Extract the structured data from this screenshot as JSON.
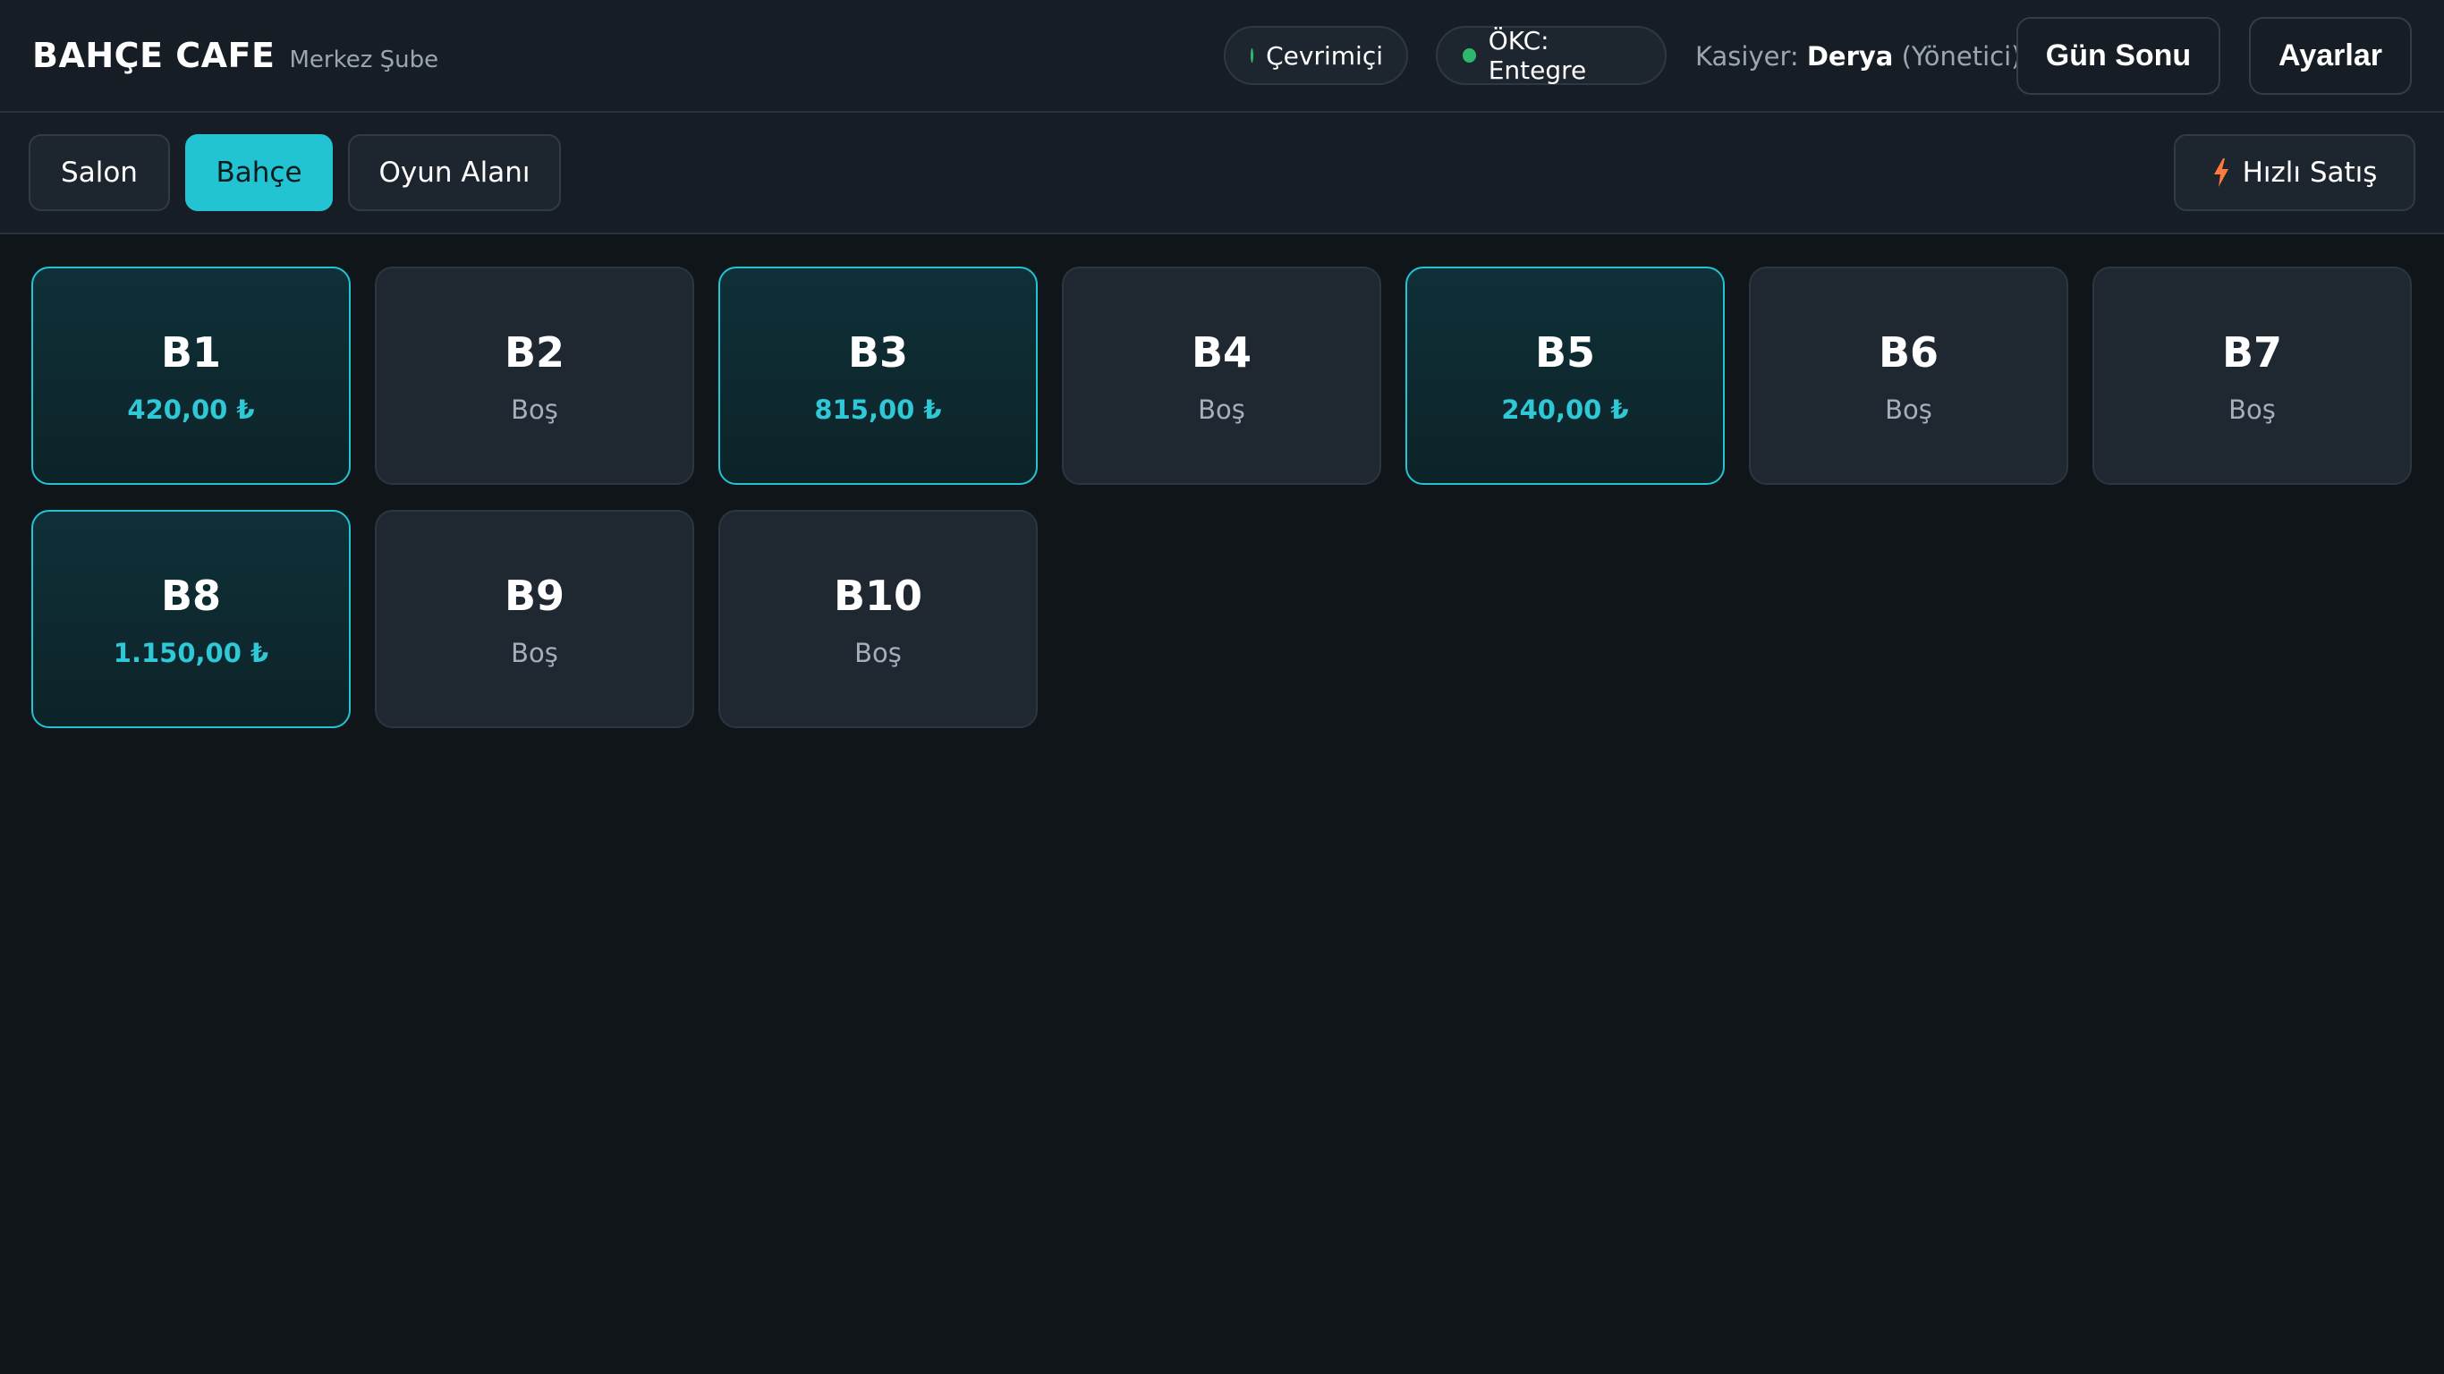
{
  "app": {
    "brand": "BAHÇE CAFE",
    "branch": "Merkez Şube"
  },
  "header": {
    "online_label": "Çevrimiçi",
    "okc_label": "ÖKC: Entegre",
    "cashier_prefix": "Kasiyer:",
    "cashier_name": "Derya",
    "cashier_role": "(Yönetici)",
    "day_end_label": "Gün Sonu",
    "settings_label": "Ayarlar",
    "status_color": "#2fb86d"
  },
  "tabs": [
    {
      "label": "Salon",
      "active": false
    },
    {
      "label": "Bahçe",
      "active": true
    },
    {
      "label": "Oyun Alanı",
      "active": false
    }
  ],
  "quick_sale": {
    "label": "Hızlı Satış",
    "icon": "lightning-icon",
    "icon_color": "#ff7a3d"
  },
  "accent_color": "#22c4d4",
  "tables": [
    {
      "name": "B1",
      "status": "420,00 ₺",
      "occupied": true
    },
    {
      "name": "B2",
      "status": "Boş",
      "occupied": false
    },
    {
      "name": "B3",
      "status": "815,00 ₺",
      "occupied": true
    },
    {
      "name": "B4",
      "status": "Boş",
      "occupied": false
    },
    {
      "name": "B5",
      "status": "240,00 ₺",
      "occupied": true
    },
    {
      "name": "B6",
      "status": "Boş",
      "occupied": false
    },
    {
      "name": "B7",
      "status": "Boş",
      "occupied": false
    },
    {
      "name": "B8",
      "status": "1.150,00 ₺",
      "occupied": true
    },
    {
      "name": "B9",
      "status": "Boş",
      "occupied": false
    },
    {
      "name": "B10",
      "status": "Boş",
      "occupied": false
    }
  ]
}
